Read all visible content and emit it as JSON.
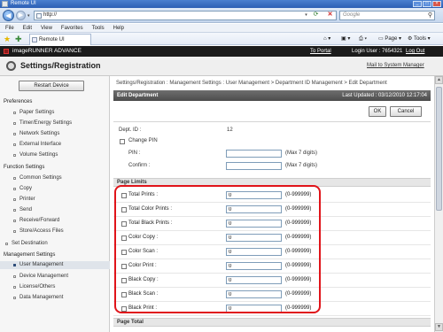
{
  "browser": {
    "title": "Remote UI",
    "url": "http://",
    "search_placeholder": "Google",
    "menu": [
      "File",
      "Edit",
      "View",
      "Favorites",
      "Tools",
      "Help"
    ],
    "tab_label": "Remote UI",
    "commands": {
      "page": "Page",
      "tools": "Tools"
    }
  },
  "app": {
    "brand": "imageRUNNER ADVANCE",
    "portal": "To Portal",
    "login": "Login User : 7654321",
    "logout": "Log Out",
    "title": "Settings/Registration",
    "mail": "Mail to System Manager"
  },
  "nav": {
    "restart": "Restart Device",
    "preferences": "Preferences",
    "pref_items": [
      "Paper Settings",
      "Timer/Energy Settings",
      "Network Settings",
      "External Interface",
      "Volume Settings"
    ],
    "function": "Function Settings",
    "func_items": [
      "Common Settings",
      "Copy",
      "Printer",
      "Send",
      "Receive/Forward",
      "Store/Access Files"
    ],
    "set_destination": "Set Destination",
    "management": "Management Settings",
    "mgmt_items": [
      "User Management",
      "Device Management",
      "License/Others",
      "Data Management"
    ]
  },
  "main": {
    "breadcrumb": "Settings/Registration : Management Settings : User Management > Department ID Management > Edit Department",
    "header": "Edit Department",
    "updated": "Last Updated : 03/12/2010 12:17:04",
    "ok": "OK",
    "cancel": "Cancel",
    "dept_label": "Dept. ID :",
    "dept_value": "12",
    "change_pin": "Change PIN",
    "pin_label": "PIN :",
    "confirm_label": "Confirm :",
    "max_digits": "(Max 7 digits)",
    "page_limits": "Page Limits",
    "page_total": "Page Total",
    "limits": [
      {
        "name": "Total Prints :",
        "value": "0",
        "range": "(0-999999)"
      },
      {
        "name": "Total Color Prints :",
        "value": "0",
        "range": "(0-999999)"
      },
      {
        "name": "Total Black Prints :",
        "value": "0",
        "range": "(0-999999)"
      },
      {
        "name": "Color Copy :",
        "value": "0",
        "range": "(0-999999)"
      },
      {
        "name": "Color Scan :",
        "value": "0",
        "range": "(0-999999)"
      },
      {
        "name": "Color Print :",
        "value": "0",
        "range": "(0-999999)"
      },
      {
        "name": "Black Copy :",
        "value": "0",
        "range": "(0-999999)"
      },
      {
        "name": "Black Scan :",
        "value": "0",
        "range": "(0-999999)"
      },
      {
        "name": "Black Print :",
        "value": "0",
        "range": "(0-999999)"
      }
    ]
  },
  "colors": {
    "highlight": "#e0141a",
    "header_dark": "#1b1b1b",
    "accent": "#2c5fb4"
  }
}
